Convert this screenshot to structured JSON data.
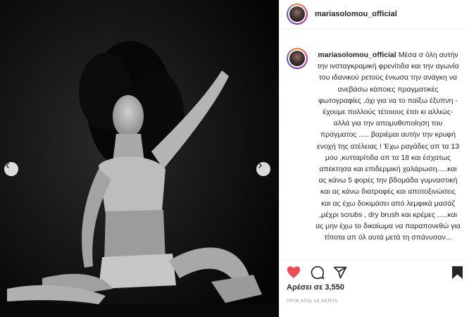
{
  "post": {
    "username": "mariasolomou_official",
    "caption_user": "mariasolomou_official",
    "caption_text": "Μέσα σ όλη αυτήν την ινσταγκραμική φρενίτιδα και την αγωνία του ιδανικού ρετούς ένιωσα την ανάγκη να ανεβάσω κάποιες πραγματικές φωτογραφίες ,όχι για να το παίξω έξυπνη - έχουμε πολλούς τέτοιους έτσι κι αλλιώς- αλλά για την απομυθοποίηση του πράγματος ..... βαριέμαι αυτήν την κρυφή ενοχή της ατέλειας ! Έχω ραγάδες απ τα 13 μου ,κυτταρίτιδα απ τα 18 και έσχατως απέκτησα και επιδερμική χαλάρωση.....και ας κάνω 5 φορές την βδομάδα γυμναστική και ας κάνω διατροφές και αποτοξινώσεις και ας έχω δοκιμάσει από λεμφικά μασάζ ,μέχρι scrubs , dry brush και κρέμες .....και ας μην έχω το δικαίωμα να παραπονεθώ για τίποτα απ όλ αυτά μετά τη σπάνυσαν... ",
    "likes": "Αρέσει σε 3,550",
    "time_ago": "ΠΡΙΝ ΑΠΟ 19 ΛΕΠΤΑ"
  },
  "icons": {
    "heart": "heart-filled-icon",
    "comment": "comment-icon",
    "share": "share-icon",
    "save": "bookmark-icon",
    "prev": "chevron-left-icon",
    "next": "chevron-right-icon"
  },
  "colors": {
    "like_red": "#ed4956",
    "text": "#262626",
    "muted": "#8e8e8e"
  }
}
